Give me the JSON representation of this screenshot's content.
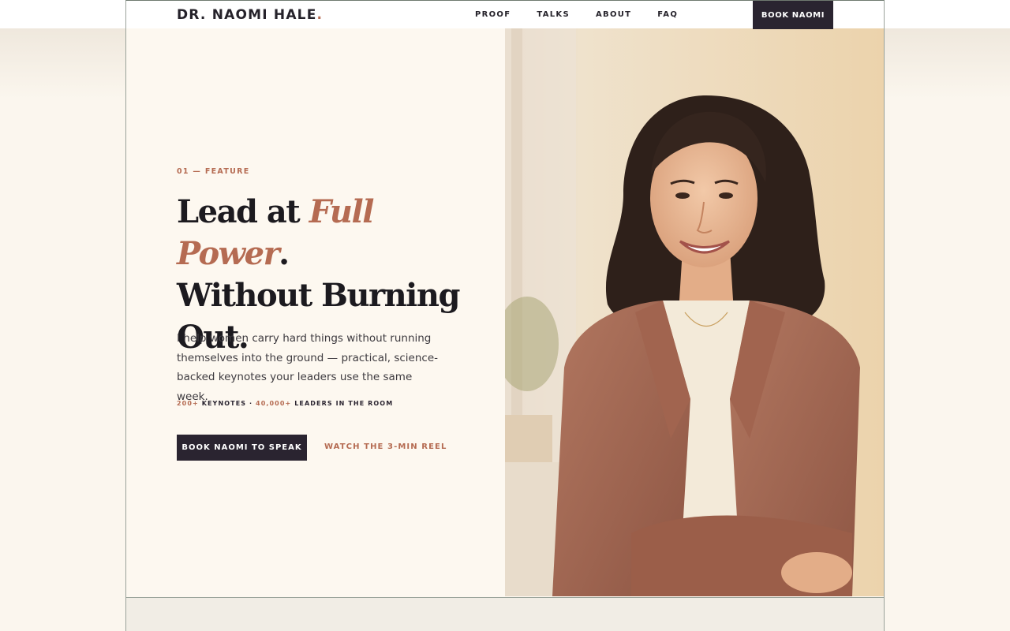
{
  "nav": {
    "logo": "DR. NAOMI HALE",
    "logo_dot": ".",
    "links": [
      "PROOF",
      "TALKS",
      "ABOUT",
      "FAQ"
    ],
    "cta": "BOOK NAOMI"
  },
  "hero": {
    "eyebrow": "01 — FEATURE",
    "headline_1": "Lead at ",
    "headline_accent": "Full Power",
    "headline_2": ".",
    "headline_3": "Without Burning Out.",
    "lede": "I help women carry hard things without running themselves into the ground — practical, science-backed keynotes your leaders use the same week.",
    "stats": {
      "keynotes_num": "200+",
      "keynotes_label": " KEYNOTES · ",
      "leaders_num": "40,000+",
      "leaders_label": " LEADERS IN THE ROOM"
    },
    "primary_cta": "BOOK NAOMI TO SPEAK",
    "secondary_cta": "WATCH THE 3-MIN REEL"
  },
  "colors": {
    "accent": "#b56b52",
    "dark": "#2a2430",
    "background": "#fdf8f0"
  }
}
